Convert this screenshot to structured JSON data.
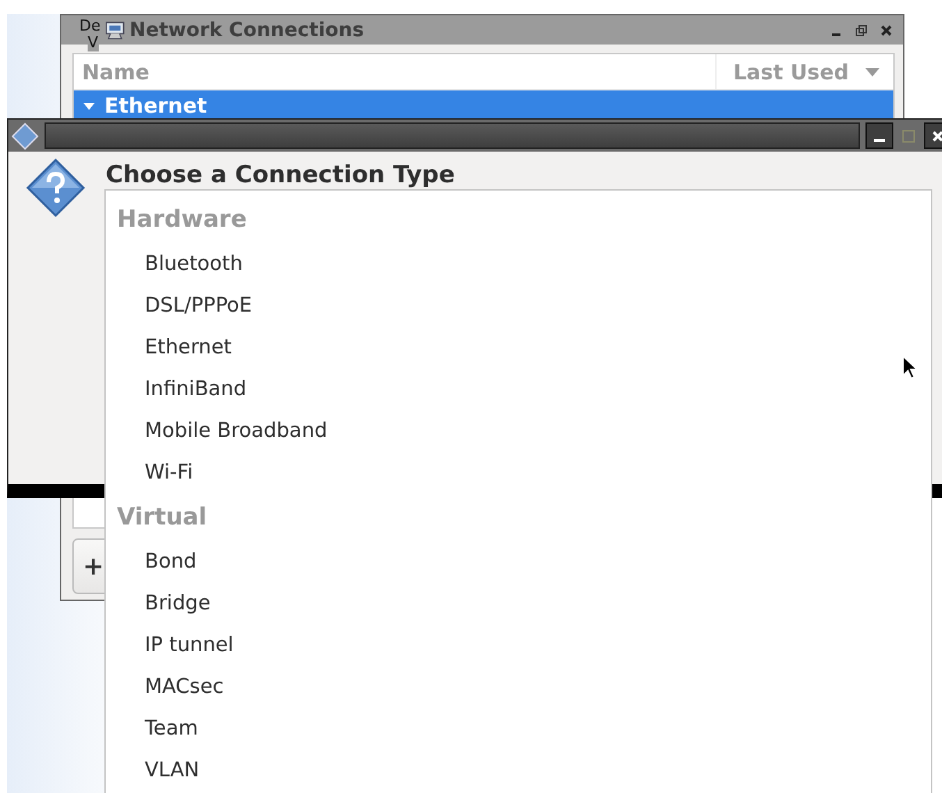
{
  "desktop": {
    "icon_label_lines": [
      "De",
      "V"
    ]
  },
  "main_window": {
    "title": "Network Connections",
    "table": {
      "columns": [
        "Name",
        "Last Used"
      ],
      "rows": [
        {
          "label": "Ethernet",
          "kind": "group",
          "expanded": true,
          "selected": true
        }
      ]
    },
    "add_button": "+"
  },
  "dialog": {
    "heading": "Choose a Connection Type",
    "menu": {
      "sections": [
        {
          "title": "Hardware",
          "items": [
            "Bluetooth",
            "DSL/PPPoE",
            "Ethernet",
            "InfiniBand",
            "Mobile Broadband",
            "Wi-Fi"
          ]
        },
        {
          "title": "Virtual",
          "items": [
            "Bond",
            "Bridge",
            "IP tunnel",
            "MACsec",
            "Team",
            "VLAN"
          ]
        }
      ]
    }
  }
}
